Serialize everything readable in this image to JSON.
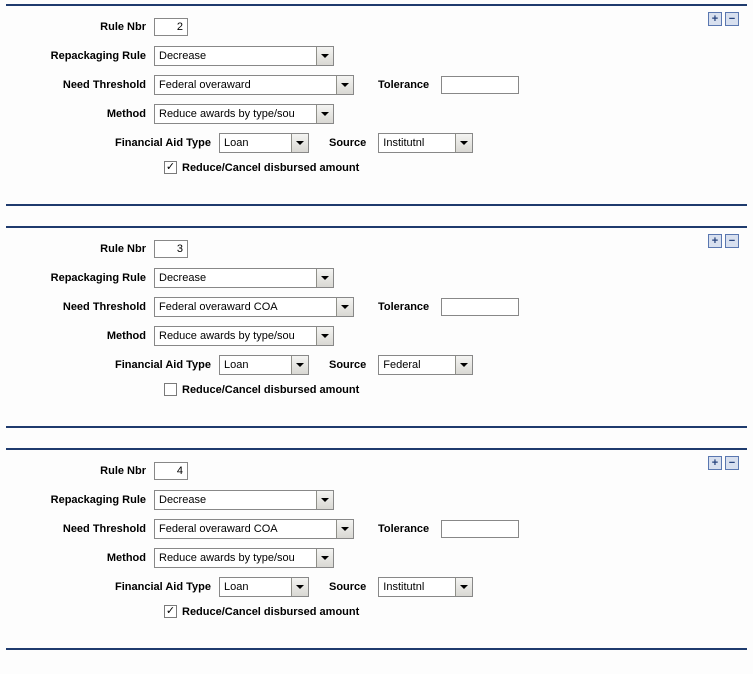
{
  "labels": {
    "ruleNbr": "Rule Nbr",
    "repackagingRule": "Repackaging Rule",
    "needThreshold": "Need Threshold",
    "method": "Method",
    "financialAidType": "Financial Aid Type",
    "tolerance": "Tolerance",
    "source": "Source",
    "reduceCancel": "Reduce/Cancel disbursed amount",
    "plus": "+",
    "minus": "−"
  },
  "rules": [
    {
      "nbr": "2",
      "repackagingRule": "Decrease",
      "needThreshold": "Federal overaward",
      "method": "Reduce awards by type/sou",
      "finAidType": "Loan",
      "source": "Institutnl",
      "tolerance": "",
      "reduceCancel": true
    },
    {
      "nbr": "3",
      "repackagingRule": "Decrease",
      "needThreshold": "Federal overaward COA",
      "method": "Reduce awards by type/sou",
      "finAidType": "Loan",
      "source": "Federal",
      "tolerance": "",
      "reduceCancel": false
    },
    {
      "nbr": "4",
      "repackagingRule": "Decrease",
      "needThreshold": "Federal overaward COA",
      "method": "Reduce awards by type/sou",
      "finAidType": "Loan",
      "source": "Institutnl",
      "tolerance": "",
      "reduceCancel": true
    }
  ]
}
